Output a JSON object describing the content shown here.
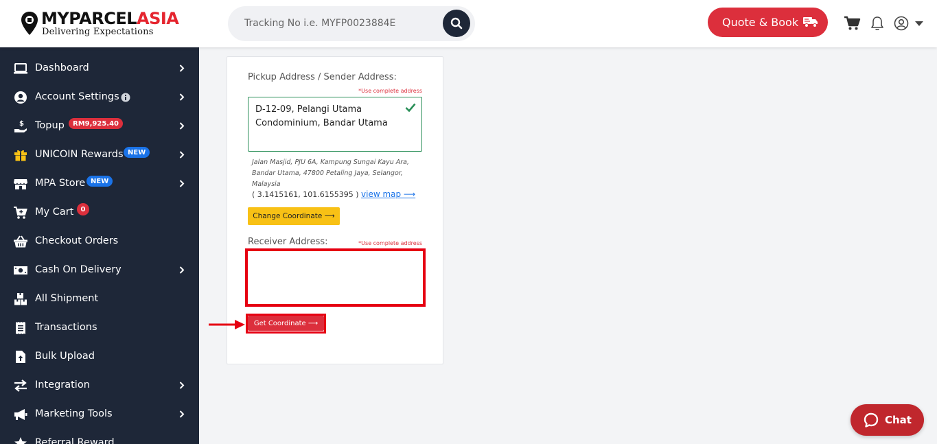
{
  "brand": {
    "name_part1": "MYPARCEL",
    "name_part2": "ASIA",
    "tagline": "Delivering Expectations",
    "color_primary": "#dc2f3c",
    "color_dark": "#1e2738"
  },
  "header": {
    "search_placeholder": "Tracking No i.e. MYFP0023884E",
    "quote_label": "Quote & Book",
    "icons": [
      "search-icon",
      "truck-icon",
      "cart-icon",
      "bell-icon",
      "user-icon",
      "caret-down-icon"
    ]
  },
  "sidebar": {
    "items": [
      {
        "label": "Dashboard",
        "icon": "laptop-icon"
      },
      {
        "label": "Account Settings",
        "icon": "user-circle-icon"
      },
      {
        "label": "Topup",
        "icon": "hand-coin-icon",
        "badge": "RM9,925.40"
      },
      {
        "label": "UNICOIN Rewards",
        "icon": "gift-icon",
        "badge": "NEW"
      },
      {
        "label": "MPA Store",
        "icon": "store-icon",
        "badge": "NEW"
      },
      {
        "label": "My Cart",
        "icon": "cart-plus-icon",
        "badge": "0"
      },
      {
        "label": "Checkout Orders",
        "icon": "basket-icon"
      },
      {
        "label": "Cash On Delivery",
        "icon": "money-icon"
      },
      {
        "label": "All Shipment",
        "icon": "boxes-icon"
      },
      {
        "label": "Transactions",
        "icon": "receipt-icon"
      },
      {
        "label": "Bulk Upload",
        "icon": "file-upload-icon"
      },
      {
        "label": "Integration",
        "icon": "exchange-icon"
      },
      {
        "label": "Marketing Tools",
        "icon": "megaphone-icon"
      },
      {
        "label": "Referral Reward",
        "icon": "star-icon"
      }
    ]
  },
  "form": {
    "pickup_label": "Pickup Address / Sender Address:",
    "hint": "*Use complete address",
    "pickup_value_line1": "D-12-09, Pelangi Utama",
    "pickup_value_line2": "Condominium, Bandar Utama",
    "resolved_address": "Jalan Masjid, PJU 6A, Kampung Sungai Kayu Ara, Bandar Utama, 47800 Petaling Jaya, Selangor, Malaysia",
    "coordinates": "( 3.1415161, 101.6155395 )",
    "view_map": "view map ⟶",
    "change_coordinate": "Change Coordinate ⟶",
    "receiver_label": "Receiver Address:",
    "receiver_value": "",
    "get_coordinate": "Get Coordinate ⟶"
  },
  "chat": {
    "label": "Chat"
  }
}
